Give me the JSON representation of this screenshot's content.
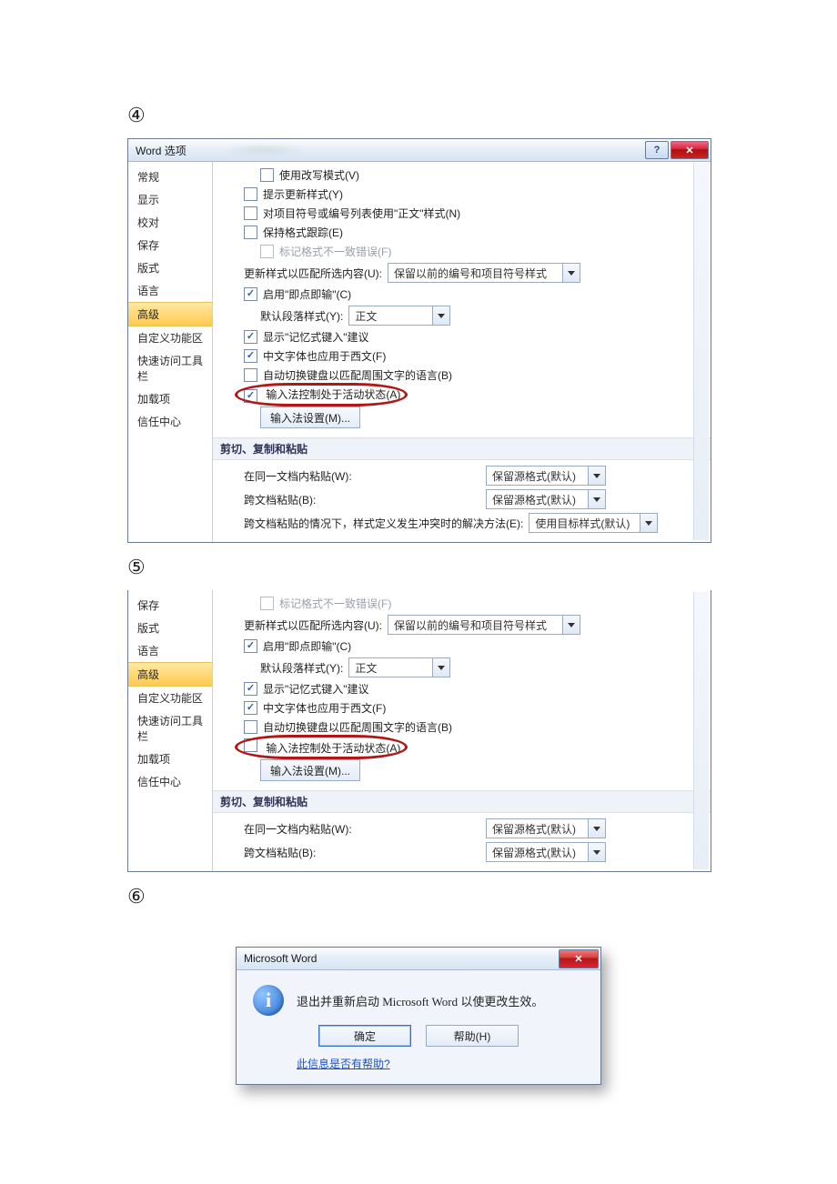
{
  "steps": {
    "s4": "④",
    "s5": "⑤",
    "s6": "⑥"
  },
  "dlg4": {
    "title": "Word 选项",
    "help": "?",
    "close": "✕",
    "sidebar": [
      "常规",
      "显示",
      "校对",
      "保存",
      "版式",
      "语言",
      "高级",
      "自定义功能区",
      "快速访问工具栏",
      "加载项",
      "信任中心"
    ],
    "sel_index": 6,
    "opt_overwrite": "使用改写模式(V)",
    "opt_prompt_update": "提示更新样式(Y)",
    "opt_list_bullets": "对项目符号或编号列表使用\"正文\"样式(N)",
    "opt_track_fmt": "保持格式跟踪(E)",
    "opt_mark_fmt": "标记格式不一致错误(F)",
    "opt_update_style": "更新样式以匹配所选内容(U):",
    "opt_update_style_val": "保留以前的编号和项目符号样式",
    "opt_click_type": "启用\"即点即输\"(C)",
    "opt_default_para": "默认段落样式(Y):",
    "opt_default_para_val": "正文",
    "opt_show_autoc": "显示\"记忆式键入\"建议",
    "opt_cn_also_west": "中文字体也应用于西文(F)",
    "opt_auto_kbd": "自动切换键盘以匹配周围文字的语言(B)",
    "opt_ime_active": "输入法控制处于活动状态(A)",
    "btn_ime_settings": "输入法设置(M)...",
    "sec_paste": "剪切、复制和粘贴",
    "paste_same_doc": "在同一文档内粘贴(W):",
    "paste_cross_doc": "跨文档粘贴(B):",
    "paste_conflict": "跨文档粘贴的情况下，样式定义发生冲突时的解决方法(E):",
    "paste_val_keep": "保留源格式(默认)",
    "paste_val_dest": "使用目标样式(默认)"
  },
  "dlg5": {
    "sidebar": [
      "保存",
      "版式",
      "语言",
      "高级",
      "自定义功能区",
      "快速访问工具栏",
      "加载项",
      "信任中心"
    ],
    "sel_index": 3
  },
  "msg": {
    "title": "Microsoft Word",
    "close": "✕",
    "info_glyph": "i",
    "text": "退出并重新启动 Microsoft Word 以使更改生效。",
    "ok": "确定",
    "help": "帮助(H)",
    "link": "此信息是否有帮助?"
  }
}
